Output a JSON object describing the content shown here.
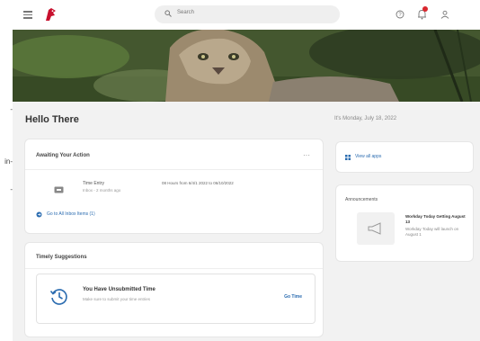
{
  "colors": {
    "accent": "#2b6cb0",
    "brand": "#c8102e",
    "badge": "#d9272e",
    "page_background": "#f2f2f2",
    "card_background": "#ffffff"
  },
  "edge": {
    "marks": [
      "-",
      "in-",
      "-"
    ]
  },
  "topbar": {
    "menu_icon": "hamburger-menu-icon",
    "logo_icon": "cougar-head-logo",
    "search_placeholder": "Search",
    "help_icon": "question-icon",
    "notifications_icon": "bell-icon",
    "profile_icon": "user-icon"
  },
  "hero": {
    "image": "cougar-photo-banner"
  },
  "page": {
    "greeting": "Hello There",
    "date": "It's Monday, July 18, 2022"
  },
  "awaiting": {
    "title": "Awaiting Your Action",
    "more_icon": "ellipsis-icon",
    "task": {
      "icon": "inbox-icon",
      "title": "Time Entry",
      "subtitle": "Inbox - 2 months ago",
      "range": "08 Hours from 6/4/1 2022 to 06/10/2022"
    },
    "view_all": "Go to All Inbox Items (1)"
  },
  "suggestions": {
    "title": "Timely Suggestions",
    "item": {
      "icon": "clock-refresh-icon",
      "title": "You Have Unsubmitted Time",
      "subtitle": "Make sure to submit your time entries",
      "action": "Go Time"
    }
  },
  "sidebar": {
    "view_all": "View all apps",
    "view_all_icon": "grid-icon",
    "announcements_title": "Announcements",
    "announcement": {
      "thumb_icon": "megaphone-icon",
      "title": "Workday Today Getting August 13",
      "body": "Workday Today will launch on August 1"
    }
  }
}
